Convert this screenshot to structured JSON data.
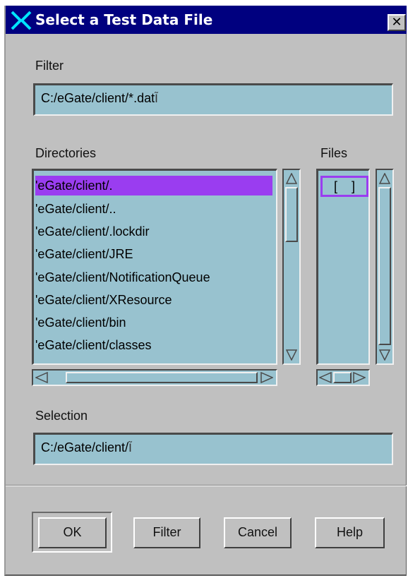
{
  "window": {
    "title": "Select a Test Data File",
    "close_glyph": "✕"
  },
  "filter": {
    "label": "Filter",
    "value": "C:/eGate/client/*.dat"
  },
  "directories": {
    "label": "Directories",
    "items": [
      "'eGate/client/.",
      "'eGate/client/..",
      "'eGate/client/.lockdir",
      "'eGate/client/JRE",
      "'eGate/client/NotificationQueue",
      "'eGate/client/XResource",
      "'eGate/client/bin",
      "'eGate/client/classes"
    ],
    "selected_index": 0
  },
  "files": {
    "label": "Files",
    "items": [
      "[    ]"
    ]
  },
  "selection": {
    "label": "Selection",
    "value": "C:/eGate/client/"
  },
  "buttons": {
    "ok": "OK",
    "filter": "Filter",
    "cancel": "Cancel",
    "help": "Help"
  },
  "colors": {
    "title_bar": "#00007f",
    "dialog_bg": "#c0c0c0",
    "field_bg": "#98c2cf",
    "selection_highlight": "#9a3df0"
  },
  "icons": {
    "app_logo": "x-logo-icon",
    "scroll_up": "arrow-up-icon",
    "scroll_down": "arrow-down-icon",
    "scroll_left": "arrow-left-icon",
    "scroll_right": "arrow-right-icon"
  }
}
